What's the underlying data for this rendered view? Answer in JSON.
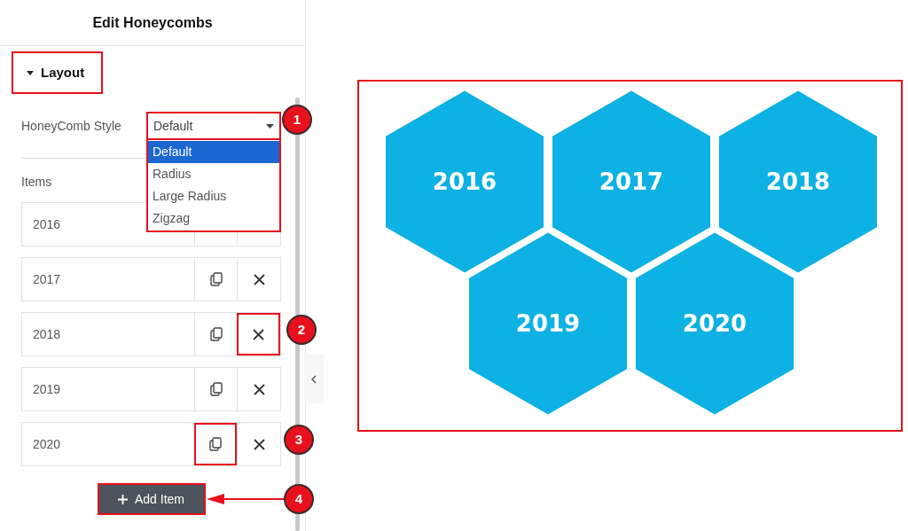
{
  "panel": {
    "title": "Edit Honeycombs"
  },
  "section": {
    "label": "Layout",
    "expanded": true,
    "highlighted": true
  },
  "style_field": {
    "label": "HoneyComb Style",
    "value": "Default",
    "highlighted": true,
    "badge": "1",
    "open": true,
    "options": [
      {
        "label": "Default",
        "selected": true
      },
      {
        "label": "Radius",
        "selected": false
      },
      {
        "label": "Large Radius",
        "selected": false
      },
      {
        "label": "Zigzag",
        "selected": false
      }
    ]
  },
  "items_label": "Items",
  "items": [
    {
      "value": "2016",
      "copy_highlighted": false,
      "delete_highlighted": false
    },
    {
      "value": "2017",
      "copy_highlighted": false,
      "delete_highlighted": false
    },
    {
      "value": "2018",
      "copy_highlighted": false,
      "delete_highlighted": true,
      "delete_badge": "2"
    },
    {
      "value": "2019",
      "copy_highlighted": false,
      "delete_highlighted": false
    },
    {
      "value": "2020",
      "copy_highlighted": true,
      "delete_highlighted": false,
      "copy_badge": "3"
    }
  ],
  "add_button": {
    "label": "Add Item",
    "highlighted": true,
    "badge": "4"
  },
  "preview": {
    "highlighted": true,
    "cells": [
      "2016",
      "2017",
      "2018",
      "2019",
      "2020"
    ]
  }
}
